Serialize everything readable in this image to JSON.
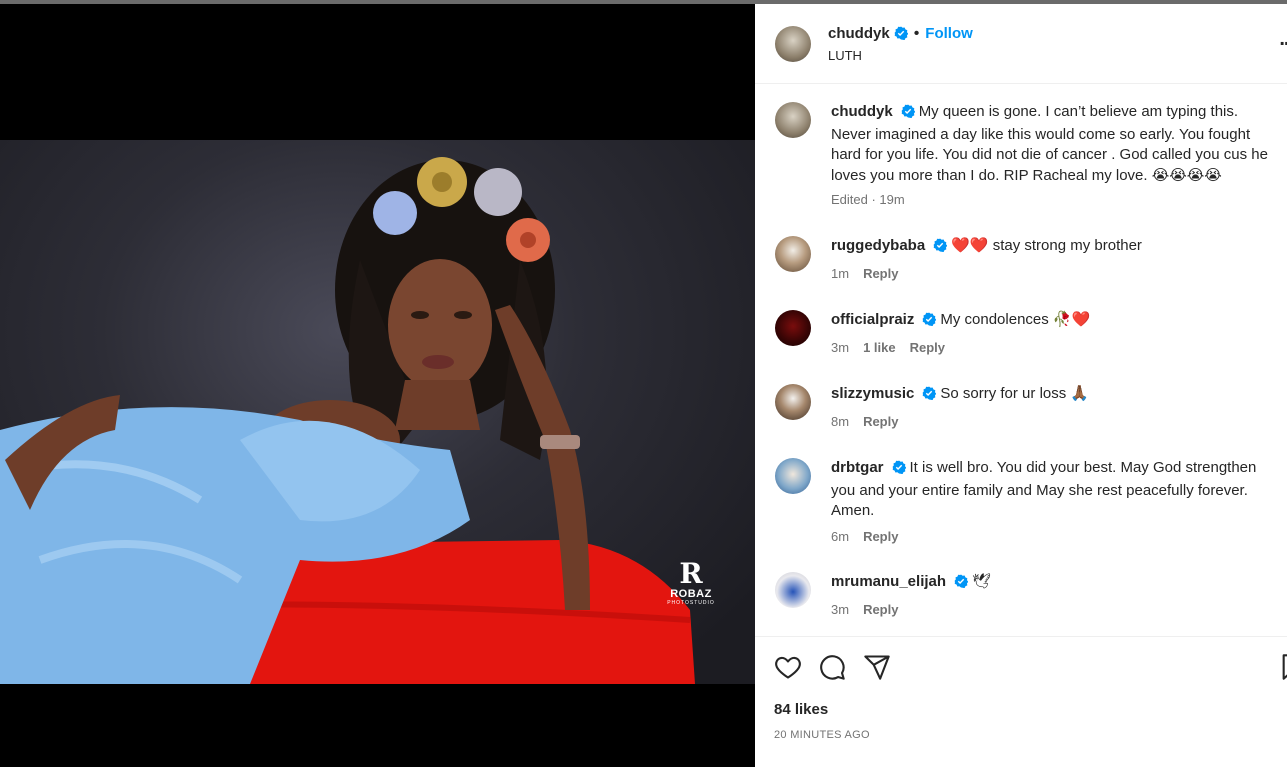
{
  "post": {
    "author": "chuddyk",
    "follow_label": "Follow",
    "separator": "•",
    "location": "LUTH",
    "more_label": "...",
    "caption": "My queen is gone. I can’t believe am typing this. Never imagined a day like this would come so early. You fought hard for you life. You did not die of cancer . God called you cus he loves you more than I do. RIP Racheal my love. 😭😭😭😭",
    "caption_meta": "Edited · 19m",
    "likes": "84 likes",
    "time_ago": "20 MINUTES AGO"
  },
  "media": {
    "watermark_mark": "R",
    "watermark_name": "ROBAZ",
    "watermark_sub": "PHOTOSTUDIO"
  },
  "comments": [
    {
      "username": "ruggedybaba",
      "text": "❤️❤️ stay strong my brother",
      "time": "1m",
      "likes": "",
      "reply": "Reply"
    },
    {
      "username": "officialpraiz",
      "text": "My condolences 🥀❤️",
      "time": "3m",
      "likes": "1 like",
      "reply": "Reply"
    },
    {
      "username": "slizzymusic",
      "text": "So sorry for ur loss 🙏🏾",
      "time": "8m",
      "likes": "",
      "reply": "Reply"
    },
    {
      "username": "drbtgar",
      "text": "It is well bro. You did your best. May God strengthen you and your entire family and May she rest peacefully forever. Amen.",
      "time": "6m",
      "likes": "",
      "reply": "Reply"
    },
    {
      "username": "mrumanu_elijah",
      "text": "🕊",
      "time": "3m",
      "likes": "",
      "reply": "Reply"
    }
  ],
  "icons": {
    "like": "heart-icon",
    "comment": "comment-icon",
    "share": "send-icon",
    "save": "bookmark-icon",
    "verified": "verified-badge-icon"
  },
  "colors": {
    "accent": "#0095f6",
    "verified": "#0095f6",
    "secondary_text": "#737373"
  }
}
